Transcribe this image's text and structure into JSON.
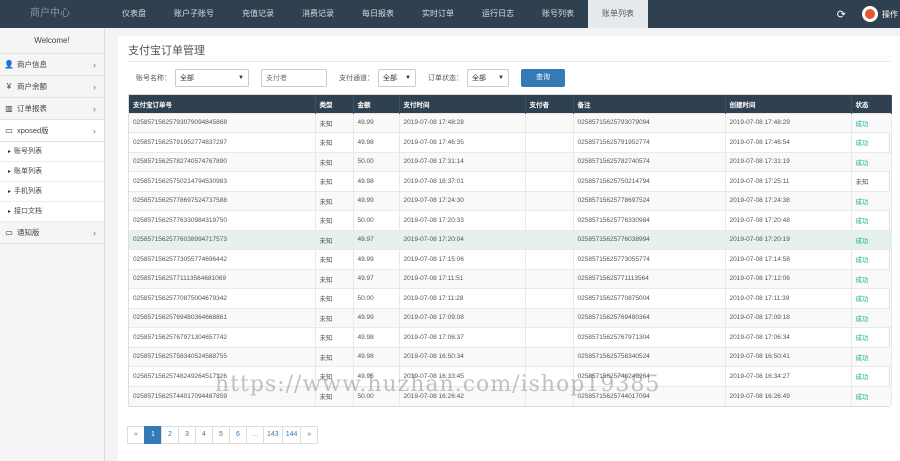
{
  "brand": "商户中心",
  "nav": [
    "仪表盘",
    "账户子账号",
    "充值记录",
    "消费记录",
    "每日报表",
    "实时订单",
    "运行日志",
    "账号列表",
    "账单列表"
  ],
  "nav_active": 8,
  "user": {
    "label": "操作"
  },
  "icons": {
    "refresh": "refresh-icon",
    "avatar": "user-avatar-icon"
  },
  "sidebar": {
    "welcome": "Welcome!",
    "items": [
      {
        "icon": "user-icon",
        "glyph": "👤",
        "label": "商户信息"
      },
      {
        "icon": "yen-icon",
        "glyph": "¥",
        "label": "商户余额"
      },
      {
        "icon": "chart-icon",
        "glyph": "▥",
        "label": "订单报表"
      },
      {
        "icon": "monitor-icon",
        "glyph": "▭",
        "label": "xposed版"
      }
    ],
    "subitems": [
      "账号列表",
      "账单列表",
      "手机列表",
      "接口文档"
    ],
    "last": {
      "icon": "monitor-icon",
      "glyph": "▭",
      "label": "通知版"
    }
  },
  "page": {
    "title": "支付宝订单管理",
    "filters": {
      "account_label": "账号名称：",
      "account_value": "全部",
      "payer_placeholder": "支付者",
      "channel_label": "支付通道：",
      "channel_value": "全部",
      "status_label": "订单状态：",
      "status_value": "全部",
      "query_button": "查询"
    }
  },
  "table": {
    "headers": [
      "支付宝订单号",
      "类型",
      "金额",
      "支付时间",
      "支付者",
      "备注",
      "创建时间",
      "状态"
    ],
    "rows": [
      [
        "0258571562579307909484586​8",
        "未知",
        "49.99",
        "2019-07-08 17:48:28",
        "",
        "02585715625793079094",
        "2019-07-08 17:48:29",
        "成功"
      ],
      [
        "02585715625791952774837297",
        "未知",
        "49.98",
        "2019-07-08 17:46:35",
        "",
        "02585715625791952774",
        "2019-07-08 17:46:54",
        "成功"
      ],
      [
        "02585715625782740574767890",
        "未知",
        "50.00",
        "2019-07-08 17:31:14",
        "",
        "02585715625782740574",
        "2019-07-08 17:31:19",
        "成功"
      ],
      [
        "02585715625750214794530983",
        "未知",
        "49.98",
        "2019-07-08 16:37:01",
        "",
        "02585715625750214794",
        "2019-07-08 17:25:11",
        "未知"
      ],
      [
        "02585715625778697524737588",
        "未知",
        "49.99",
        "2019-07-08 17:24:30",
        "",
        "02585715625778697524",
        "2019-07-08 17:24:38",
        "成功"
      ],
      [
        "02585715625776330984319750",
        "未知",
        "50.00",
        "2019-07-08 17:20:33",
        "",
        "02585715625776330984",
        "2019-07-08 17:20:48",
        "成功"
      ],
      [
        "02585715625776038994717573",
        "未知",
        "49.97",
        "2019-07-08 17:20:04",
        "",
        "02585715625776038994",
        "2019-07-08 17:20:19",
        "成功"
      ],
      [
        "02585715625773055774696442",
        "未知",
        "49.99",
        "2019-07-08 17:15:06",
        "",
        "02585715625773055774",
        "2019-07-08 17:14:58",
        "成功"
      ],
      [
        "02585715625771113564681069",
        "未知",
        "49.97",
        "2019-07-08 17:11:51",
        "",
        "02585715625771113564",
        "2019-07-08 17:12:06",
        "成功"
      ],
      [
        "02585715625770875004679342",
        "未知",
        "50.00",
        "2019-07-08 17:11:28",
        "",
        "02585715625770875004",
        "2019-07-08 17:11:39",
        "成功"
      ],
      [
        "02585715625769480364668861",
        "未知",
        "49.99",
        "2019-07-08 17:09:08",
        "",
        "02585715625769480364",
        "2019-07-08 17:09:18",
        "成功"
      ],
      [
        "02585715625767971304657742",
        "未知",
        "49.98",
        "2019-07-08 17:06:37",
        "",
        "02585715625767971304",
        "2019-07-08 17:06:34",
        "成功"
      ],
      [
        "02585715625758340524588755",
        "未知",
        "49.98",
        "2019-07-08 16:50:34",
        "",
        "02585715625758340524",
        "2019-07-08 16:50:41",
        "成功"
      ],
      [
        "02585715625748249264517126",
        "未知",
        "49.95",
        "2019-07-08 16:33:45",
        "",
        "02585715625748249264",
        "2019-07-08 16:34:27",
        "成功"
      ],
      [
        "02585715625744017094487859",
        "未知",
        "50.00",
        "2019-07-08 16:26:42",
        "",
        "02585715625744017094",
        "2019-07-08 16:26:49",
        "成功"
      ]
    ]
  },
  "pagination": [
    "«",
    "1",
    "2",
    "3",
    "4",
    "5",
    "6",
    "...",
    "143",
    "144",
    "»"
  ],
  "pagination_active": "1",
  "watermark": "https://www.huzhan.com/ishop19385"
}
